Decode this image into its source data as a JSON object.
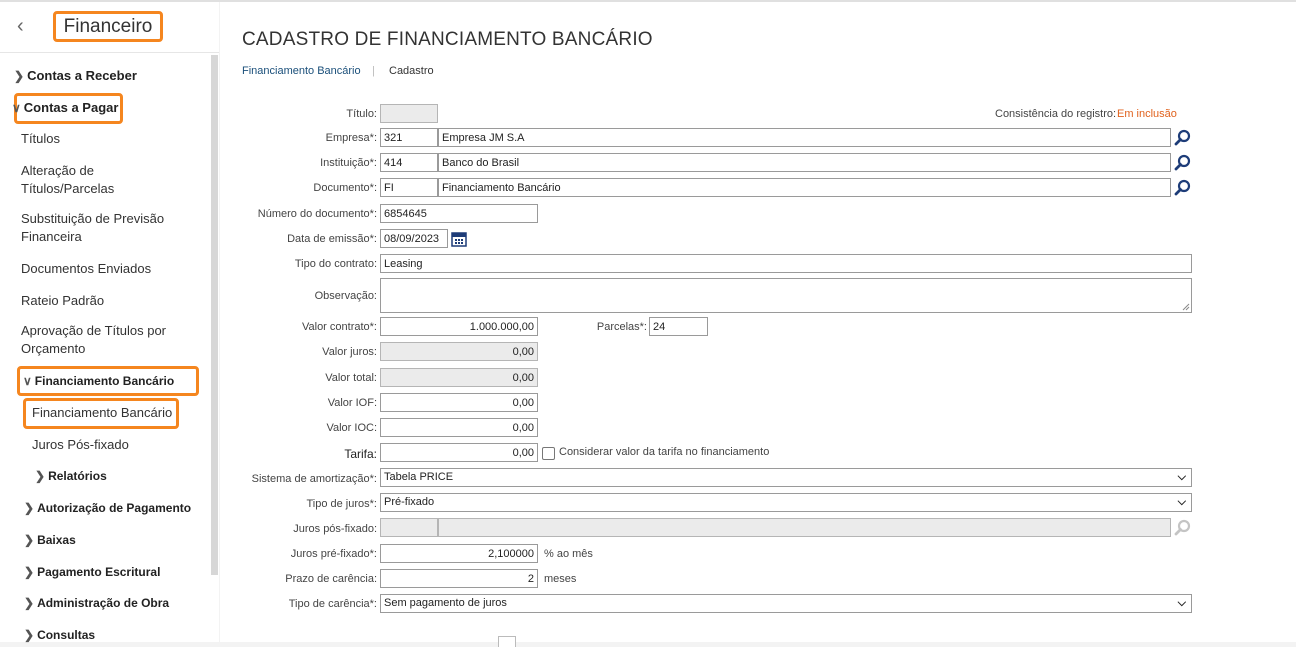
{
  "sidebar": {
    "title": "Financeiro",
    "items": [
      {
        "label": "Contas a Receber"
      },
      {
        "label": "Contas a Pagar"
      },
      {
        "label": "Títulos"
      },
      {
        "label": "Alteração de Títulos/Parcelas"
      },
      {
        "label": "Substituição de Previsão Financeira"
      },
      {
        "label": "Documentos Enviados"
      },
      {
        "label": "Rateio Padrão"
      },
      {
        "label": "Aprovação de Títulos por Orçamento"
      },
      {
        "label": "Financiamento Bancário"
      },
      {
        "label": "Financiamento Bancário"
      },
      {
        "label": "Juros Pós-fixado"
      },
      {
        "label": "Relatórios"
      },
      {
        "label": "Autorização de Pagamento"
      },
      {
        "label": "Baixas"
      },
      {
        "label": "Pagamento Escritural"
      },
      {
        "label": "Administração de Obra"
      },
      {
        "label": "Consultas"
      }
    ]
  },
  "page": {
    "title": "CADASTRO DE FINANCIAMENTO BANCÁRIO",
    "breadcrumb": [
      "Financiamento Bancário",
      "Cadastro"
    ],
    "consistency_label": "Consistência do registro:",
    "consistency_value": "Em inclusão"
  },
  "form": {
    "titulo": {
      "label": "Título:",
      "value": ""
    },
    "empresa": {
      "label": "Empresa*:",
      "code": "321",
      "name": "Empresa JM S.A"
    },
    "instituicao": {
      "label": "Instituição*:",
      "code": "414",
      "name": "Banco do Brasil"
    },
    "documento": {
      "label": "Documento*:",
      "code": "FI",
      "name": "Financiamento Bancário"
    },
    "numero_documento": {
      "label": "Número do documento*:",
      "value": "6854645"
    },
    "data_emissao": {
      "label": "Data de emissão*:",
      "value": "08/09/2023"
    },
    "tipo_contrato": {
      "label": "Tipo do contrato:",
      "value": "Leasing"
    },
    "observacao": {
      "label": "Observação:",
      "value": ""
    },
    "valor_contrato": {
      "label": "Valor contrato*:",
      "value": "1.000.000,00"
    },
    "parcelas": {
      "label": "Parcelas*:",
      "value": "24"
    },
    "valor_juros": {
      "label": "Valor juros:",
      "value": "0,00"
    },
    "valor_total": {
      "label": "Valor total:",
      "value": "0,00"
    },
    "valor_iof": {
      "label": "Valor IOF:",
      "value": "0,00"
    },
    "valor_ioc": {
      "label": "Valor IOC:",
      "value": "0,00"
    },
    "tarifa": {
      "label": "Tarifa:",
      "value": "0,00",
      "checkbox_label": "Considerar valor da tarifa no financiamento"
    },
    "sistema_amortizacao": {
      "label": "Sistema de amortização*:",
      "value": "Tabela PRICE"
    },
    "tipo_juros": {
      "label": "Tipo de juros*:",
      "value": "Pré-fixado"
    },
    "juros_pos": {
      "label": "Juros pós-fixado:",
      "code": "",
      "name": ""
    },
    "juros_pre": {
      "label": "Juros pré-fixado*:",
      "value": "2,100000",
      "unit": "% ao mês"
    },
    "prazo_carencia": {
      "label": "Prazo de carência:",
      "value": "2",
      "unit": "meses"
    },
    "tipo_carencia": {
      "label": "Tipo de carência*:",
      "value": "Sem pagamento de juros"
    }
  },
  "colors": {
    "accent": "#f5861f",
    "link": "#1a4f7a",
    "consistency": "#e0621e"
  }
}
